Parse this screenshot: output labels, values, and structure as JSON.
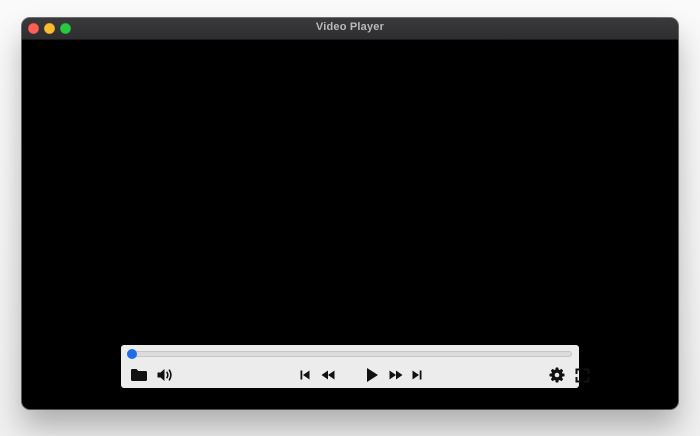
{
  "window": {
    "title": "Video Player",
    "traffic_lights": {
      "close_color": "#ff5f57",
      "minimize_color": "#febc2e",
      "zoom_color": "#28c840"
    }
  },
  "player": {
    "progress": 0,
    "accent_color": "#1e73e8",
    "controls": {
      "left": [
        "folder-icon",
        "volume-icon"
      ],
      "center": [
        "skip-back-icon",
        "rewind-icon",
        "play-icon",
        "fast-forward-icon",
        "skip-forward-icon"
      ],
      "right": [
        "settings-icon",
        "fullscreen-icon"
      ]
    }
  }
}
